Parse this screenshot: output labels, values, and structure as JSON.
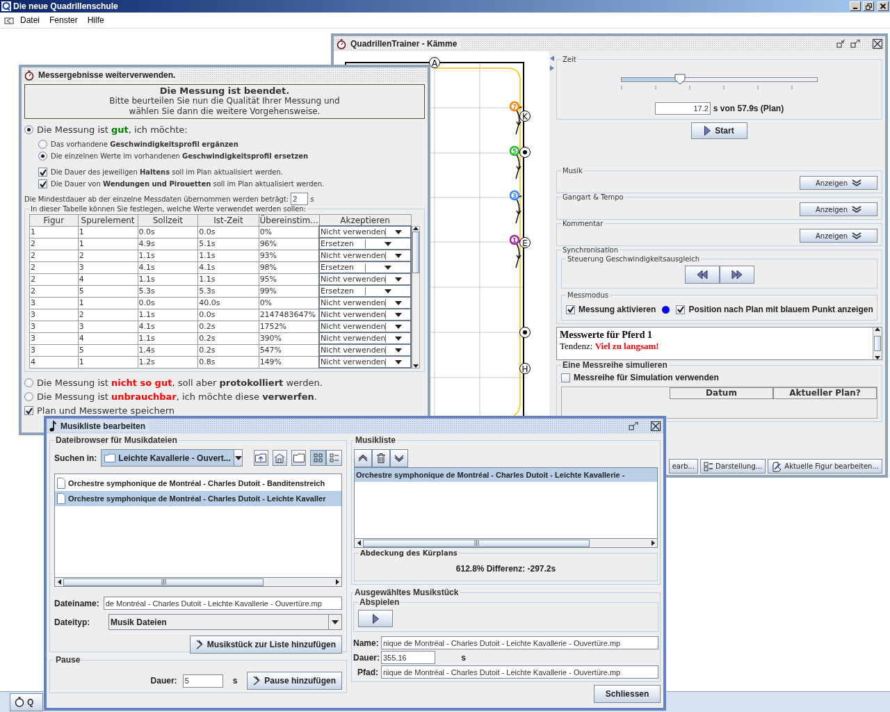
{
  "app": {
    "title": "Die neue Quadrillenschule",
    "menu": [
      "Datei",
      "Fenster",
      "Hilfe"
    ]
  },
  "trainer": {
    "title": "QuadrillenTrainer - Kämme",
    "arena": {
      "markers": [
        {
          "kind": "letter",
          "label": "A"
        },
        {
          "kind": "letter",
          "label": "K"
        },
        {
          "kind": "point"
        },
        {
          "kind": "letter",
          "label": "E"
        },
        {
          "kind": "point"
        },
        {
          "kind": "letter",
          "label": "H"
        }
      ],
      "horses": [
        {
          "number": "7",
          "color": "#ff8000"
        },
        {
          "number": "5",
          "color": "#22bb22"
        },
        {
          "number": "3",
          "color": "#3388ff"
        },
        {
          "number": "1",
          "color": "#aa22aa"
        }
      ]
    },
    "zeit": {
      "legend": "Zeit",
      "level": 0.3,
      "value": "17.2",
      "suffix": "s von 57.9s (Plan)",
      "start": "Start"
    },
    "sections": [
      {
        "legend": "Musik",
        "button": "Anzeigen"
      },
      {
        "legend": "Gangart & Tempo",
        "button": "Anzeigen"
      },
      {
        "legend": "Kommentar",
        "button": "Anzeigen"
      }
    ],
    "sync": {
      "legend": "Synchronisation",
      "control_legend": "Steuerung Geschwindigkeitsausgleich",
      "mode_legend": "Messmodus",
      "options": [
        {
          "label": "Messung aktivieren",
          "checked": true
        },
        {
          "label": "Position nach Plan mit blauem Punkt  anzeigen",
          "checked": true
        }
      ]
    },
    "messwerte": {
      "title": "Messwerte für Pferd 1",
      "tendenz_label": "Tendenz:",
      "tendenz": "Viel zu langsam!"
    },
    "simulation": {
      "legend": "Eine Messreihe simulieren",
      "checkbox": {
        "label": "Messreihe für Simulation verwenden",
        "checked": false
      },
      "columns": [
        "Datum",
        "Aktueller Plan?"
      ]
    },
    "toolbar": [
      "earb...",
      "Darstellung...",
      "Aktuelle Figur bearbeiten..."
    ]
  },
  "results": {
    "title": "Messergebnisse weiterverwenden.",
    "notice": {
      "heading": "Die Messung ist beendet.",
      "lines": [
        "Bitte beurteilen Sie nun die Qualität Ihrer Messung und",
        "wählen Sie dann die weitere Vorgehensweise."
      ]
    },
    "quality_options": [
      {
        "parts": [
          {
            "text": "Die Messung ist ",
            "kind": "plain"
          },
          {
            "text": "gut",
            "kind": "good"
          },
          {
            "text": ", ich möchte:",
            "kind": "plain"
          }
        ],
        "selected": true
      },
      {
        "parts": [
          {
            "text": "Die Messung ist ",
            "kind": "plain"
          },
          {
            "text": "nicht so gut",
            "kind": "bad"
          },
          {
            "text": ", soll aber ",
            "kind": "plain"
          },
          {
            "text": "protokolliert",
            "kind": "strong"
          },
          {
            "text": " werden.",
            "kind": "plain"
          }
        ],
        "selected": false
      },
      {
        "parts": [
          {
            "text": "Die Messung ist ",
            "kind": "plain"
          },
          {
            "text": "unbrauchbar",
            "kind": "bad"
          },
          {
            "text": ", ich möchte diese ",
            "kind": "plain"
          },
          {
            "text": "verwerfen",
            "kind": "strong"
          },
          {
            "text": ".",
            "kind": "plain"
          }
        ],
        "selected": false
      }
    ],
    "sub_options": [
      {
        "text": "Das vorhandene **Geschwindigkeitsprofil ergänzen**",
        "selected": false
      },
      {
        "text": "Die einzelnen Werte im vorhandenen **Geschwindigkeitsprofil ersetzen**",
        "selected": true
      }
    ],
    "update_checks": [
      {
        "text": "Die Dauer des jeweiligen **Haltens** soll im Plan aktualisiert werden.",
        "checked": true
      },
      {
        "text": "Die Dauer von **Wendungen und Pirouetten** soll im Plan aktualisiert werden.",
        "checked": true
      }
    ],
    "min_duration": {
      "label": "Die Mindestdauer ab der einzelne Messdaten übernommen werden beträgt:",
      "value": "2",
      "unit": "s"
    },
    "table": {
      "legend": "In dieser Tabelle können Sie festlegen, welche Werte verwendet werden sollen:",
      "columns": [
        "Figur",
        "Spurelement",
        "Sollzeit",
        "Ist-Zeit",
        "Übereinstim...",
        "Akzeptieren"
      ],
      "rows": [
        {
          "cells": [
            "1",
            "1",
            "0.0s",
            "0.0s",
            "0%"
          ],
          "accept": "Nicht verwenden"
        },
        {
          "cells": [
            "2",
            "1",
            "4.9s",
            "5.1s",
            "96%"
          ],
          "accept": "Ersetzen"
        },
        {
          "cells": [
            "2",
            "2",
            "1.1s",
            "1.1s",
            "93%"
          ],
          "accept": "Nicht verwenden"
        },
        {
          "cells": [
            "2",
            "3",
            "4.1s",
            "4.1s",
            "98%"
          ],
          "accept": "Ersetzen"
        },
        {
          "cells": [
            "2",
            "4",
            "1.1s",
            "1.1s",
            "95%"
          ],
          "accept": "Nicht verwenden"
        },
        {
          "cells": [
            "2",
            "5",
            "5.3s",
            "5.3s",
            "99%"
          ],
          "accept": "Ersetzen"
        },
        {
          "cells": [
            "3",
            "1",
            "0.0s",
            "40.0s",
            "0%"
          ],
          "accept": "Nicht verwenden"
        },
        {
          "cells": [
            "3",
            "2",
            "1.1s",
            "0.0s",
            "2147483647%"
          ],
          "accept": "Nicht verwenden"
        },
        {
          "cells": [
            "3",
            "3",
            "4.1s",
            "0.2s",
            "1752%"
          ],
          "accept": "Nicht verwenden"
        },
        {
          "cells": [
            "3",
            "4",
            "1.1s",
            "0.2s",
            "390%"
          ],
          "accept": "Nicht verwenden"
        },
        {
          "cells": [
            "3",
            "5",
            "1.4s",
            "0.2s",
            "547%"
          ],
          "accept": "Nicht verwenden"
        },
        {
          "cells": [
            "4",
            "1",
            "1.2s",
            "0.8s",
            "149%"
          ],
          "accept": "Nicht verwenden"
        }
      ]
    },
    "save_check": {
      "label": "Plan und Messwerte speichern",
      "checked": true
    }
  },
  "music": {
    "title": "Musikliste bearbeiten",
    "browser": {
      "legend": "Dateibrowser für Musikdateien",
      "look_in_label": "Suchen in:",
      "look_in": "Leichte Kavallerie - Ouvert...",
      "files": [
        {
          "name": "Orchestre symphonique de Montréal - Charles Dutoit - Banditenstreich",
          "selected": false
        },
        {
          "name": "Orchestre symphonique de Montréal - Charles Dutoit - Leichte Kavaller",
          "selected": true
        }
      ],
      "filename_label": "Dateiname:",
      "filename": "de Montréal - Charles Dutoit - Leichte Kavallerie - Ouvertüre.mp",
      "filetype_label": "Dateityp:",
      "filetype": "Musik Dateien",
      "add_button": "Musikstück zur Liste hinzufügen"
    },
    "pause": {
      "legend": "Pause",
      "label": "Dauer:",
      "value": "5",
      "unit": "s",
      "button": "Pause hinzufügen"
    },
    "playlist": {
      "legend": "Musikliste",
      "items": [
        {
          "name": "Orchestre symphonique de Montréal - Charles Dutoit - Leichte Kavallerie -",
          "selected": true
        }
      ],
      "coverage_legend": "Abdeckung des Kürplans",
      "coverage": "612.8% Differenz: -297.2s"
    },
    "selected": {
      "legend": "Ausgewähltes Musikstück",
      "play_legend": "Abspielen",
      "name_label": "Name:",
      "name": "nique de Montréal - Charles Dutoit - Leichte Kavallerie - Ouvertüre.mp",
      "duration_label": "Dauer:",
      "duration": "355.16",
      "unit": "s",
      "path_label": "Pfad:",
      "path": "nique de Montréal - Charles Dutoit - Leichte Kavallerie - Ouvertüre.mp"
    },
    "close": "Schliessen"
  },
  "taskbar": [
    {
      "label": "Q"
    }
  ]
}
